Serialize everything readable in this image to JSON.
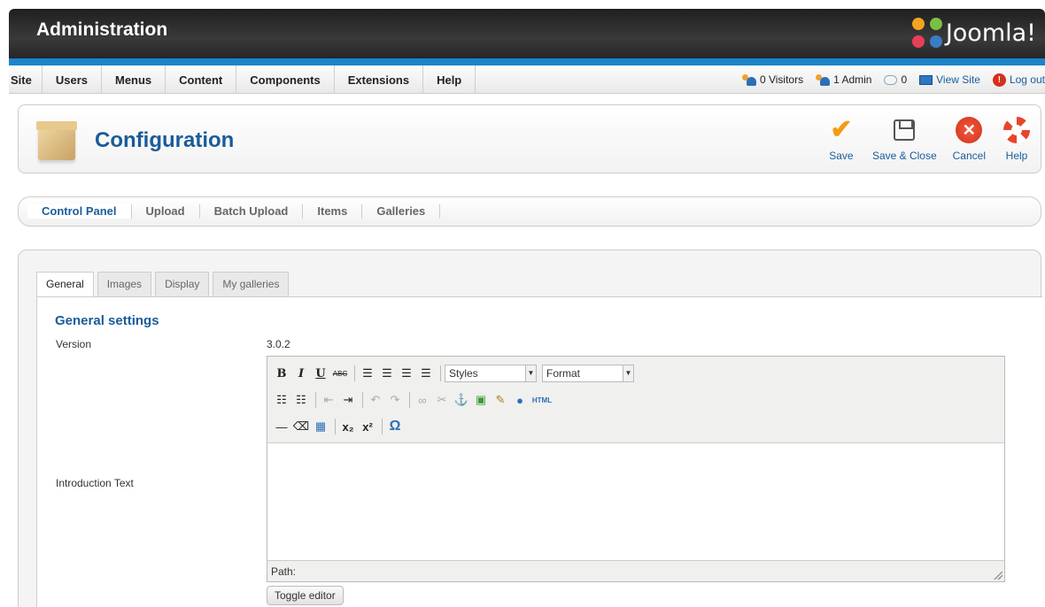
{
  "header": {
    "title": "Administration",
    "logo_text": "Joomla!"
  },
  "menu": {
    "items": [
      "Site",
      "Users",
      "Menus",
      "Content",
      "Components",
      "Extensions",
      "Help"
    ]
  },
  "status": {
    "visitors": "0 Visitors",
    "admins": "1 Admin",
    "messages": "0",
    "view_site": "View Site",
    "logout": "Log out"
  },
  "toolbar": {
    "title": "Configuration",
    "save": "Save",
    "save_close": "Save & Close",
    "cancel": "Cancel",
    "help": "Help"
  },
  "submenu": {
    "items": [
      "Control Panel",
      "Upload",
      "Batch Upload",
      "Items",
      "Galleries"
    ],
    "active": "Control Panel"
  },
  "tabs": {
    "items": [
      "General",
      "Images",
      "Display",
      "My galleries"
    ],
    "active": "General"
  },
  "general": {
    "section_title": "General settings",
    "version_label": "Version",
    "version_value": "3.0.2",
    "intro_label": "Introduction Text"
  },
  "editor": {
    "styles_select": "Styles",
    "format_select": "Format",
    "path_label": "Path:",
    "toggle_label": "Toggle editor"
  },
  "colors": {
    "header_bg": "#262626",
    "accent_blue": "#1d83c9",
    "title_blue": "#1a5c9a",
    "save_orange": "#f39c12",
    "cancel_red": "#d2331b"
  }
}
